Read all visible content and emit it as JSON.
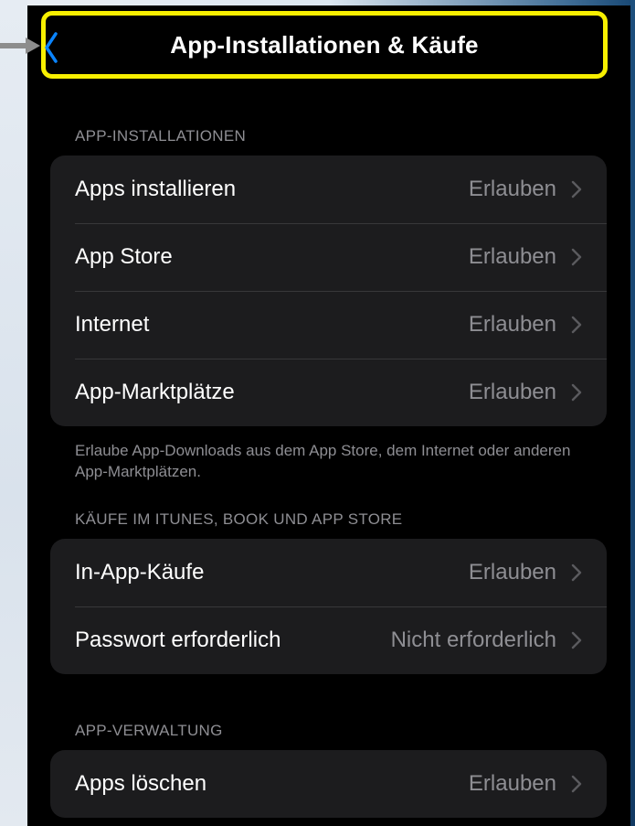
{
  "header": {
    "title": "App-Installationen & Käufe",
    "back_icon": "chevron-left-icon"
  },
  "colors": {
    "highlight_border": "#f7ef00",
    "accent_blue": "#0a84ff",
    "background": "#000000",
    "group_background": "#1c1c1e",
    "secondary_text": "#8e8e93"
  },
  "sections": [
    {
      "header": "APP-INSTALLATIONEN",
      "rows": [
        {
          "label": "Apps installieren",
          "value": "Erlauben"
        },
        {
          "label": "App Store",
          "value": "Erlauben"
        },
        {
          "label": "Internet",
          "value": "Erlauben"
        },
        {
          "label": "App-Marktplätze",
          "value": "Erlauben"
        }
      ],
      "footer": "Erlaube App-Downloads aus dem App Store, dem Internet oder anderen App-Marktplätzen."
    },
    {
      "header": "KÄUFE IM ITUNES, BOOK UND APP STORE",
      "rows": [
        {
          "label": "In-App-Käufe",
          "value": "Erlauben"
        },
        {
          "label": "Passwort erforderlich",
          "value": "Nicht erforderlich"
        }
      ]
    },
    {
      "header": "APP-VERWALTUNG",
      "rows": [
        {
          "label": "Apps löschen",
          "value": "Erlauben"
        }
      ]
    }
  ]
}
